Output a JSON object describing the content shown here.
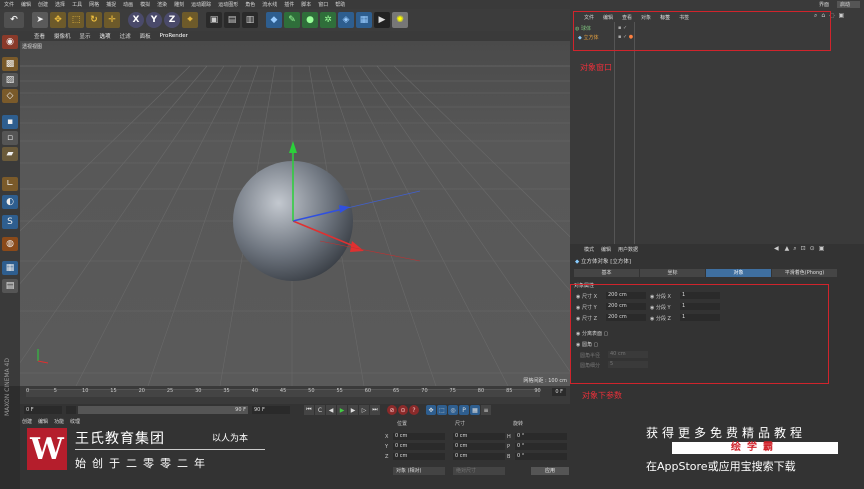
{
  "menubar": {
    "items": [
      "文件",
      "编辑",
      "创建",
      "选择",
      "工具",
      "网格",
      "捕捉",
      "动画",
      "模拟",
      "渲染",
      "雕刻",
      "运动跟踪",
      "运动图形",
      "角色",
      "流水线",
      "插件",
      "脚本",
      "窗口",
      "帮助"
    ],
    "layout_label": "界面",
    "layout_value": "启动"
  },
  "viewport": {
    "menu": [
      "查看",
      "摄像机",
      "显示",
      "选项",
      "过滤",
      "面板",
      "ProRender"
    ],
    "title": "透视视图",
    "scale": "网格间距 : 100 cm"
  },
  "timeline": {
    "ticks": [
      "0",
      "5",
      "10",
      "15",
      "20",
      "25",
      "30",
      "35",
      "40",
      "45",
      "50",
      "55",
      "60",
      "65",
      "70",
      "75",
      "80",
      "85",
      "90"
    ],
    "end_frame": "0 F"
  },
  "transport": {
    "start": "0 F",
    "current": "0 F",
    "range_end": "90 F",
    "end": "90 F"
  },
  "bottom_tabs": [
    "创建",
    "编辑",
    "功能",
    "纹理"
  ],
  "coords": {
    "headers": [
      "位置",
      "尺寸",
      "旋转"
    ],
    "rows": [
      {
        "axis": "X",
        "pos": "0 cm",
        "size": "0 cm",
        "rot_label": "H",
        "rot": "0 °"
      },
      {
        "axis": "Y",
        "pos": "0 cm",
        "size": "0 cm",
        "rot_label": "P",
        "rot": "0 °"
      },
      {
        "axis": "Z",
        "pos": "0 cm",
        "size": "0 cm",
        "rot_label": "B",
        "rot": "0 °"
      }
    ],
    "mode": "对象 (相对)",
    "size_mode": "绝对尺寸",
    "apply": "应用"
  },
  "object_manager": {
    "menu": [
      "文件",
      "编辑",
      "查看",
      "对象",
      "标签",
      "书签"
    ],
    "objects": [
      "球体",
      "立方体"
    ],
    "annotation": "对象窗口"
  },
  "attributes": {
    "menu": [
      "模式",
      "编辑",
      "用户数据"
    ],
    "title": "立方体对象 [立方体]",
    "tabs": [
      "基本",
      "坐标",
      "对象",
      "平滑着色(Phong)"
    ],
    "active_tab": "对象",
    "section": "对象属性",
    "size_label": "尺寸",
    "size": [
      {
        "axis": "X",
        "value": "200 cm",
        "seg_label": "分段 X",
        "seg": "1"
      },
      {
        "axis": "Y",
        "value": "200 cm",
        "seg_label": "分段 Y",
        "seg": "1"
      },
      {
        "axis": "Z",
        "value": "200 cm",
        "seg_label": "分段 Z",
        "seg": "1"
      }
    ],
    "separate": "分离表面",
    "fillet": "圆角",
    "fillet_radius_label": "圆角半径",
    "fillet_radius": "40 cm",
    "fillet_sub_label": "圆角细分",
    "fillet_sub": "5",
    "annotation": "对象下参数"
  },
  "brand": {
    "logo": "W",
    "name": "王氏教育集团",
    "slogan": "以人为本",
    "sub": "始创于二零零二年",
    "maxon": "MAXON CINEMA 4D"
  },
  "promo": {
    "line1": "获得更多免费精品教程",
    "badge": "绘学霸",
    "line3": "在AppStore或应用宝搜索下载"
  },
  "colors": {
    "accent": "#3f6fa0",
    "annotation": "#d0242c",
    "brand_red": "#b51e2c"
  }
}
